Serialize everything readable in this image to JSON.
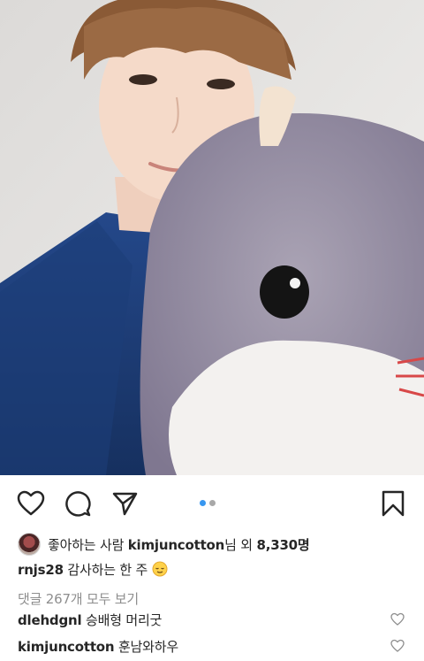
{
  "post": {
    "photo_alt": "",
    "carousel": {
      "count": 2,
      "active_index": 0
    },
    "colors": {
      "dot_active": "#3897f0",
      "dot_inactive": "#a8a8a8",
      "text_muted": "#8e8e8e"
    }
  },
  "actions": {
    "like_icon": "heart-icon",
    "comment_icon": "comment-icon",
    "share_icon": "send-icon",
    "save_icon": "bookmark-icon"
  },
  "likes": {
    "prefix": "좋아하는 사람 ",
    "user": "kimjuncotton",
    "suffix": "님 외 ",
    "count": "8,330명"
  },
  "caption": {
    "username": "rnjs28",
    "text": " 감사하는 한 주 ",
    "emoji": "relieved-face"
  },
  "view_comments": "댓글 267개 모두 보기",
  "comments": [
    {
      "username": "dlehdgnl",
      "text": " 승배형 머리굿"
    },
    {
      "username": "kimjuncotton",
      "text": " 훈남와하우"
    }
  ]
}
